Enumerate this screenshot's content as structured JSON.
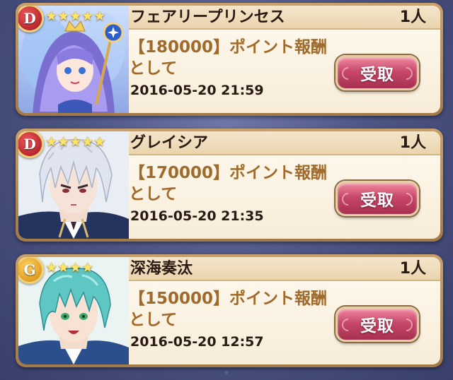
{
  "colors": {
    "claim_button": "#c8486a",
    "reward_text": "#a06a2a",
    "badge_d": "#c0262b",
    "badge_g": "#e8a316",
    "star": "#ffe566"
  },
  "entries": [
    {
      "rank": "D",
      "stars": 5,
      "name": "フェアリープリンセス",
      "count": "1人",
      "reward": "【180000】ポイント報酬\nとして",
      "date": "2016-05-20 21:59",
      "claim_label": "受取",
      "portrait_icon": "fairy-princess-portrait-icon"
    },
    {
      "rank": "D",
      "stars": 5,
      "name": "グレイシア",
      "count": "1人",
      "reward": "【170000】ポイント報酬\nとして",
      "date": "2016-05-20 21:35",
      "claim_label": "受取",
      "portrait_icon": "silver-hair-character-portrait-icon"
    },
    {
      "rank": "G",
      "stars": 4,
      "name": "深海奏汰",
      "count": "1人",
      "reward": "【150000】ポイント報酬\nとして",
      "date": "2016-05-20 12:57",
      "claim_label": "受取",
      "portrait_icon": "teal-hair-character-portrait-icon"
    }
  ]
}
